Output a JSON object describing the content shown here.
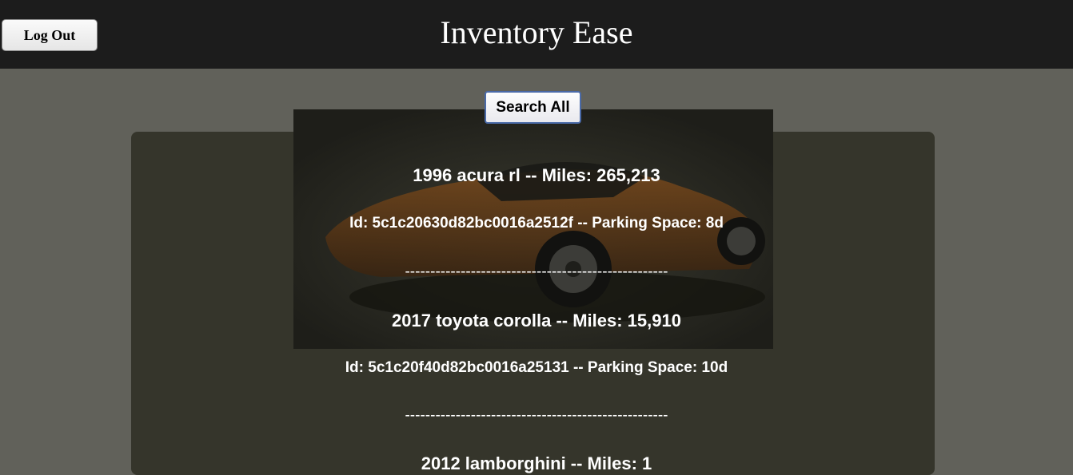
{
  "header": {
    "title": "Inventory Ease",
    "logout_label": "Log Out"
  },
  "search": {
    "button_label": "Search All"
  },
  "results": [
    {
      "title": "1996 acura rl -- Miles: 265,213",
      "detail": "Id: 5c1c20630d82bc0016a2512f -- Parking Space: 8d",
      "separator": "----------------------------------------------------"
    },
    {
      "title": "2017 toyota corolla -- Miles: 15,910",
      "detail": "Id: 5c1c20f40d82bc0016a25131 -- Parking Space: 10d",
      "separator": "----------------------------------------------------"
    },
    {
      "title": "2012 lamborghini -- Miles: 1"
    }
  ],
  "colors": {
    "header_bg": "#1c1c1c",
    "page_bg": "#61615a",
    "panel_bg": "#35352b",
    "hero_car": "#8a4a12"
  }
}
